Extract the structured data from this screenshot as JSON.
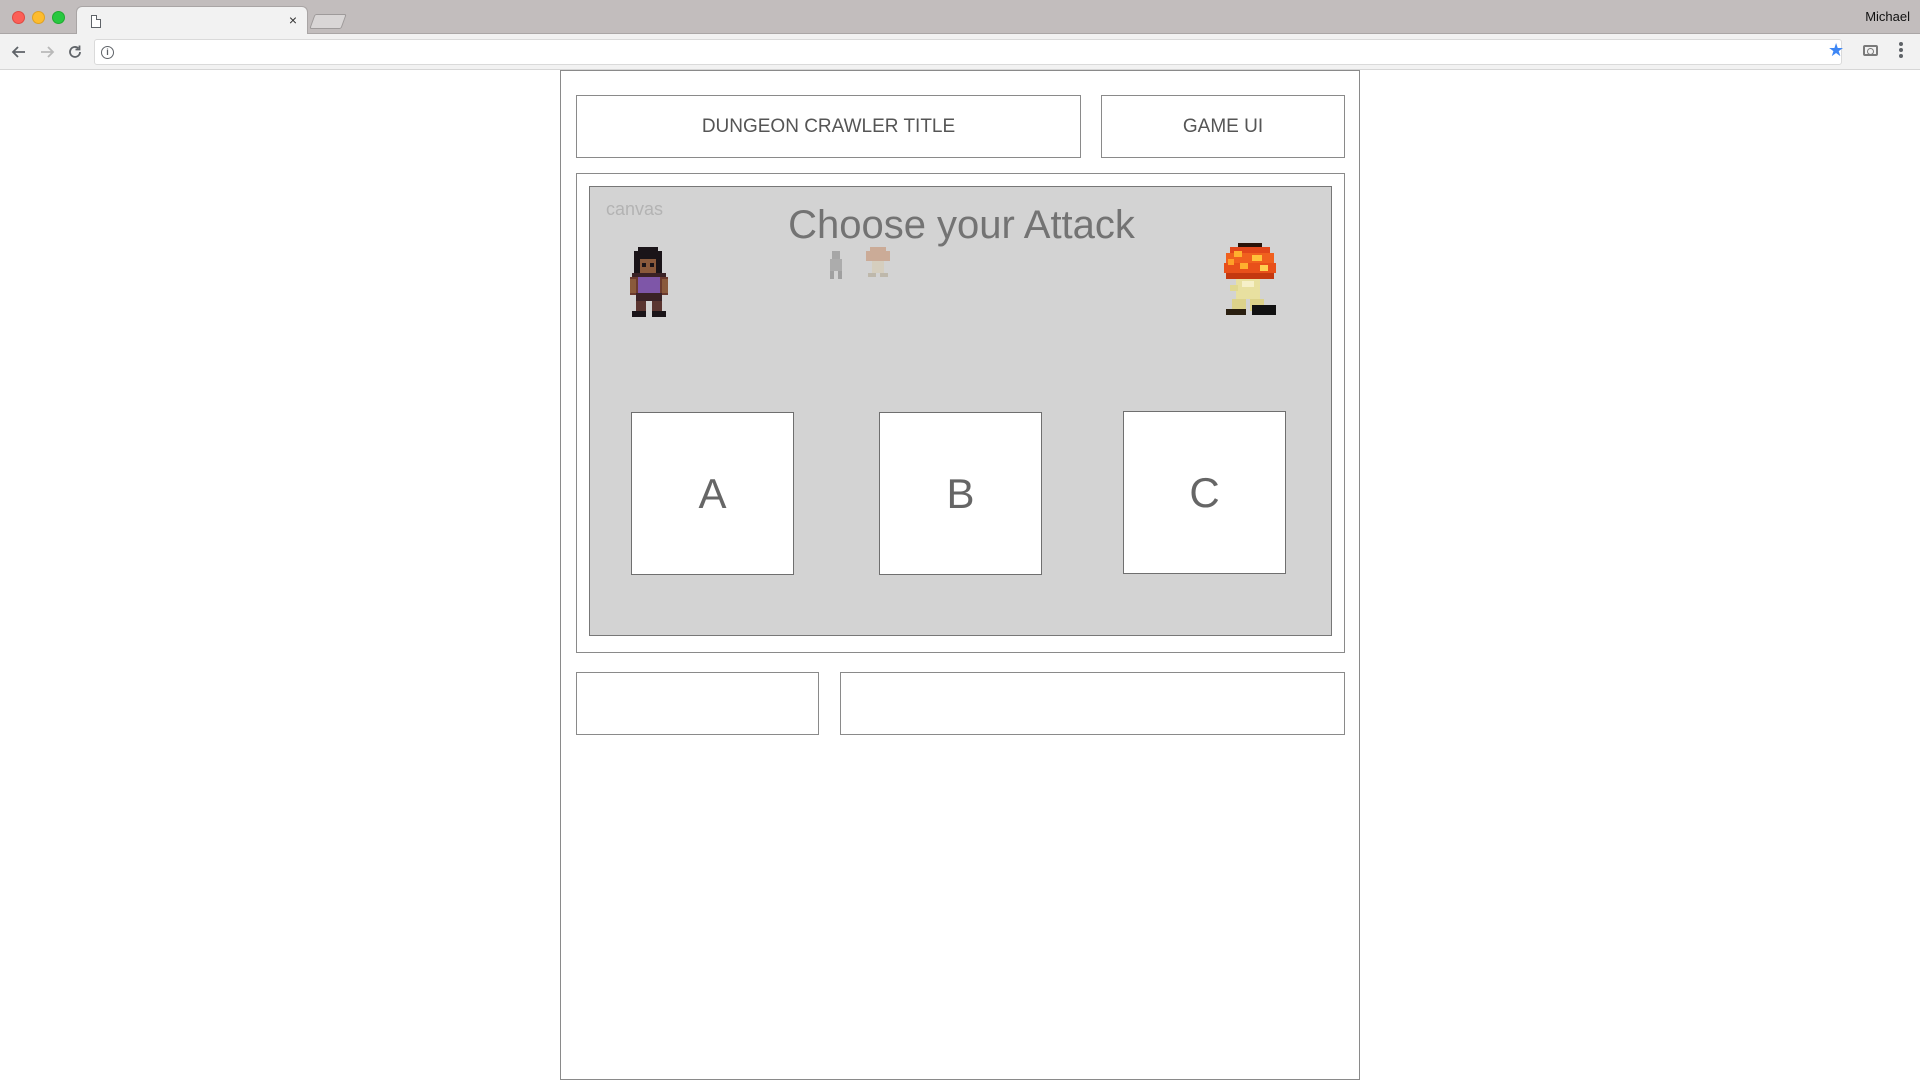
{
  "browser": {
    "tab_title": "",
    "tab_close": "×",
    "profile_name": "Michael",
    "url": "",
    "accent_color": "#3d86f5"
  },
  "game": {
    "title_box": "DUNGEON CRAWLER TITLE",
    "ui_box": "GAME UI",
    "canvas_label": "canvas",
    "prompt": "Choose your Attack",
    "attacks": [
      {
        "label": "A"
      },
      {
        "label": "B"
      },
      {
        "label": "C"
      }
    ],
    "bottom_left": "",
    "bottom_right": "",
    "canvas_color": "#d3d3d3"
  },
  "icons": {
    "back": "back-arrow-icon",
    "forward": "forward-arrow-icon",
    "reload": "reload-icon",
    "info": "info-icon",
    "bookmark": "star-icon",
    "screenshot": "camera-icon",
    "menu": "kebab-menu-icon"
  }
}
